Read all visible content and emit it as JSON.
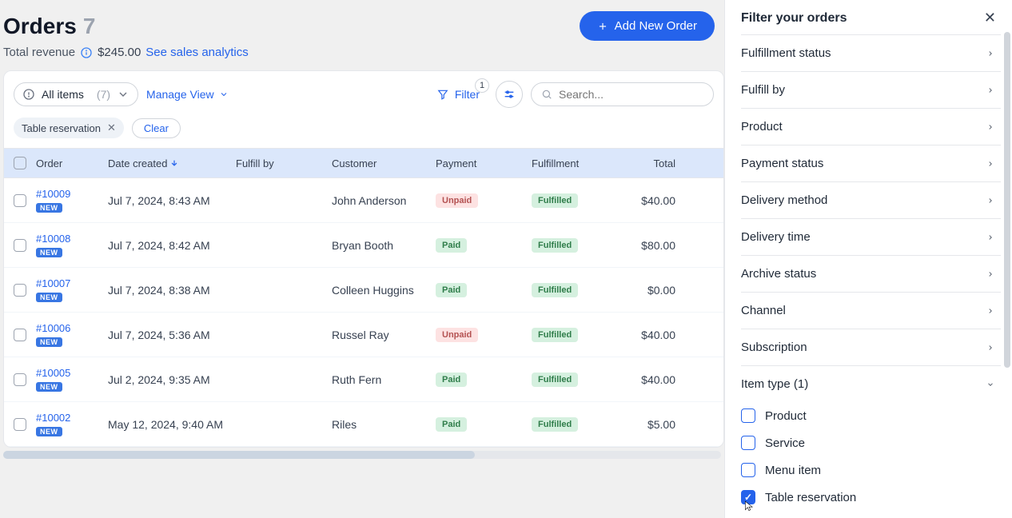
{
  "header": {
    "title": "Orders",
    "count": "7",
    "revenue_label": "Total revenue",
    "revenue_amount": "$245.00",
    "analytics_link": "See sales analytics",
    "add_button": "Add New Order"
  },
  "toolbar": {
    "view_label": "All items",
    "view_count": "(7)",
    "manage_view": "Manage View",
    "filter_label": "Filter",
    "filter_count": "1",
    "search_placeholder": "Search..."
  },
  "chips": {
    "active_filter": "Table reservation",
    "clear": "Clear"
  },
  "columns": {
    "order": "Order",
    "date": "Date created",
    "fulfill_by": "Fulfill by",
    "customer": "Customer",
    "payment": "Payment",
    "fulfillment": "Fulfillment",
    "total": "Total"
  },
  "badges": {
    "new": "NEW"
  },
  "rows": [
    {
      "id": "#10009",
      "date": "Jul 7, 2024, 8:43 AM",
      "customer": "John Anderson",
      "payment": "Unpaid",
      "payClass": "unpaid",
      "fulfillment": "Fulfilled",
      "total": "$40.00"
    },
    {
      "id": "#10008",
      "date": "Jul 7, 2024, 8:42 AM",
      "customer": "Bryan Booth",
      "payment": "Paid",
      "payClass": "paid",
      "fulfillment": "Fulfilled",
      "total": "$80.00"
    },
    {
      "id": "#10007",
      "date": "Jul 7, 2024, 8:38 AM",
      "customer": "Colleen Huggins",
      "payment": "Paid",
      "payClass": "paid",
      "fulfillment": "Fulfilled",
      "total": "$0.00"
    },
    {
      "id": "#10006",
      "date": "Jul 7, 2024, 5:36 AM",
      "customer": "Russel Ray",
      "payment": "Unpaid",
      "payClass": "unpaid",
      "fulfillment": "Fulfilled",
      "total": "$40.00"
    },
    {
      "id": "#10005",
      "date": "Jul 2, 2024, 9:35 AM",
      "customer": "Ruth Fern",
      "payment": "Paid",
      "payClass": "paid",
      "fulfillment": "Fulfilled",
      "total": "$40.00"
    },
    {
      "id": "#10002",
      "date": "May 12, 2024, 9:40 AM",
      "customer": "Riles",
      "payment": "Paid",
      "payClass": "paid",
      "fulfillment": "Fulfilled",
      "total": "$5.00"
    }
  ],
  "filter_panel": {
    "title": "Filter your orders",
    "sections": [
      {
        "label": "Fulfillment status",
        "expanded": false
      },
      {
        "label": "Fulfill by",
        "expanded": false
      },
      {
        "label": "Product",
        "expanded": false
      },
      {
        "label": "Payment status",
        "expanded": false
      },
      {
        "label": "Delivery method",
        "expanded": false
      },
      {
        "label": "Delivery time",
        "expanded": false
      },
      {
        "label": "Archive status",
        "expanded": false
      },
      {
        "label": "Channel",
        "expanded": false
      },
      {
        "label": "Subscription",
        "expanded": false
      },
      {
        "label": "Item type (1)",
        "expanded": true
      }
    ],
    "item_type_options": [
      {
        "label": "Product",
        "checked": false
      },
      {
        "label": "Service",
        "checked": false
      },
      {
        "label": "Menu item",
        "checked": false
      },
      {
        "label": "Table reservation",
        "checked": true
      }
    ]
  }
}
